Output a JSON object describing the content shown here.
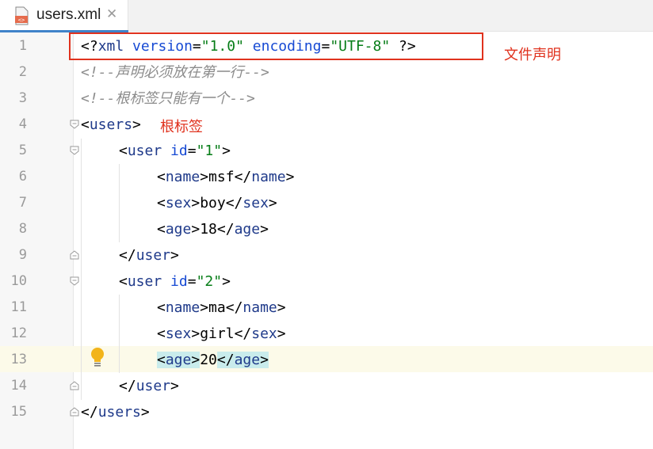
{
  "tab": {
    "title": "users.xml",
    "close_glyph": "✕",
    "icon": "xml-file-icon"
  },
  "line_numbers": [
    "1",
    "2",
    "3",
    "4",
    "5",
    "6",
    "7",
    "8",
    "9",
    "10",
    "11",
    "12",
    "13",
    "14",
    "15"
  ],
  "code": {
    "l1": {
      "open": "<?",
      "pi": "xml",
      "a1": "version",
      "eq": "=",
      "v1": "\"1.0\"",
      "a2": "encoding",
      "v2": "\"UTF-8\"",
      "close": "?>"
    },
    "l2": "<!--声明必须放在第一行-->",
    "l3": "<!--根标签只能有一个-->",
    "l4": {
      "lt": "<",
      "name": "users",
      "gt": ">"
    },
    "l5": {
      "lt": "<",
      "name": "user",
      "attr": "id",
      "eq": "=",
      "val": "\"1\"",
      "gt": ">"
    },
    "l6": {
      "name": "name",
      "text": "msf"
    },
    "l7": {
      "name": "sex",
      "text": "boy"
    },
    "l8": {
      "name": "age",
      "text": "18"
    },
    "l9": {
      "lt": "</",
      "name": "user",
      "gt": ">"
    },
    "l10": {
      "lt": "<",
      "name": "user",
      "attr": "id",
      "eq": "=",
      "val": "\"2\"",
      "gt": ">"
    },
    "l11": {
      "name": "name",
      "text": "ma"
    },
    "l12": {
      "name": "sex",
      "text": "girl"
    },
    "l13": {
      "name": "age",
      "text": "20"
    },
    "l14": {
      "lt": "</",
      "name": "user",
      "gt": ">"
    },
    "l15": {
      "lt": "</",
      "name": "users",
      "gt": ">"
    }
  },
  "annotations": {
    "declaration": "文件声明",
    "root_tag": "根标签"
  },
  "colors": {
    "accent": "#4083c9",
    "annotation": "#e0321e",
    "tag": "#1f3a8a",
    "value": "#067d17",
    "comment": "#8c8c8c"
  }
}
